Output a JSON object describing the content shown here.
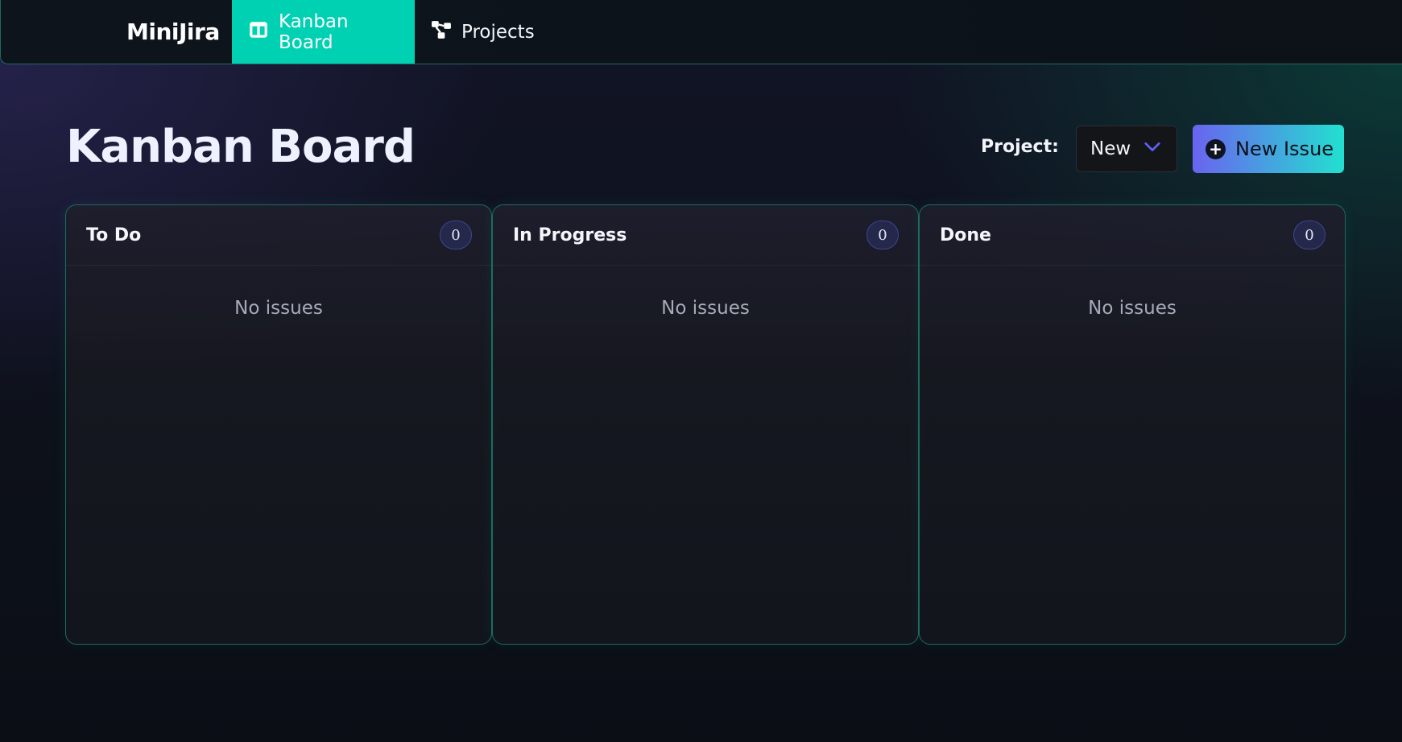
{
  "nav": {
    "brand": "MiniJira",
    "items": [
      {
        "label": "Kanban Board",
        "icon": "columns-icon",
        "active": true
      },
      {
        "label": "Projects",
        "icon": "sitemap-icon",
        "active": false
      }
    ]
  },
  "header": {
    "title": "Kanban Board",
    "project_label": "Project:",
    "project_selected": "New",
    "new_issue_label": "New Issue"
  },
  "columns": [
    {
      "title": "To Do",
      "count": "0",
      "empty_text": "No issues"
    },
    {
      "title": "In Progress",
      "count": "0",
      "empty_text": "No issues"
    },
    {
      "title": "Done",
      "count": "0",
      "empty_text": "No issues"
    }
  ],
  "colors": {
    "accent": "#00d1b2",
    "button_gradient_start": "#6a63f0",
    "button_gradient_end": "#22e0d0",
    "column_border": "#1d6b5f",
    "count_badge": "#24284a"
  }
}
